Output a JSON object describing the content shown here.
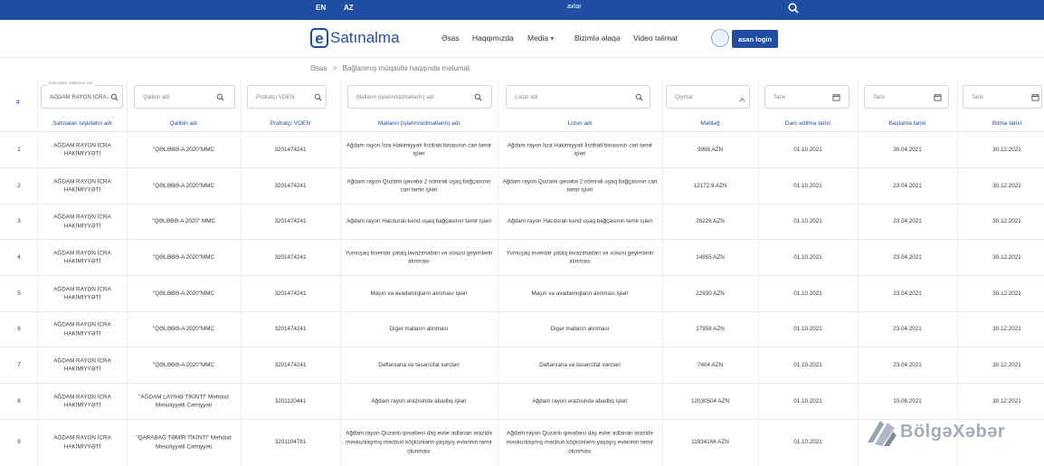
{
  "topbar": {
    "lang_en": "EN",
    "lang_az": "AZ",
    "search_text": "axtar",
    "search_icon": "search-icon"
  },
  "colors": {
    "primary": "#1f4ea3",
    "header_text": "#1f4ea3",
    "row_text": "#3a3a3a"
  },
  "navbar": {
    "logo_letter": "e",
    "logo_text": "Satınalma",
    "items": [
      "Əsas",
      "Haqqımızda",
      "Media",
      "Bizimlə əlaqə",
      "Video təlimat"
    ],
    "login_label": "asan login"
  },
  "breadcrumb": {
    "home": "Əsas",
    "separator": ">",
    "current": "Bağlanmış müqavilə haqqında məlumat"
  },
  "filters": {
    "hash": "#",
    "org_label": "Satınalan təşkilatın adı",
    "org_value": "AĞDAM RAYON İCRA..",
    "template_placeholder": "Qalibin adı",
    "voen_placeholder": "Podratçı VOEN",
    "goods_placeholder": "Malların (işlərin/xidmətlərin) adı",
    "lot_placeholder": "Lotun adı",
    "price_placeholder": "Qiymət",
    "date1_placeholder": "Tarix",
    "date2_placeholder": "Tarix",
    "date3_placeholder": "Tarix"
  },
  "table": {
    "columns": [
      "Satınalan təşkilatın adı",
      "Qalibin adı",
      "Podratçı VOEN",
      "Malların (işlərin/xidmətlərin) adı",
      "Lotun adı",
      "Məbləğ",
      "Dərc edilmə tarixi",
      "Başlama tarixi",
      "Bitmə tarixi"
    ],
    "rows": [
      {
        "num": "1",
        "org": "AĞDAM RAYON İCRA HAKİMİYYƏTİ",
        "winner": "\"QƏLƏBƏ-A 2020\"MMC",
        "voen": "3201474241",
        "goods": "Ağdam rayon İcra Hakimiyyəti İnzibati binasının cari təmir işləri",
        "lot": "Ağdam rayon İcra Hakimiyyəti İnzibati binasının cari təmir işləri",
        "amount": "9998 AZN",
        "published": "01.10.2021",
        "start": "30.04.2021",
        "end": "30.12.2021"
      },
      {
        "num": "2",
        "org": "AĞDAM RAYON İCRA HAKİMİYYƏTİ",
        "winner": "\"QƏLƏBƏ-A 2020\"MMC",
        "voen": "3201474241",
        "goods": "Ağdam rayon Quzanlı qəsəbə 2 nömrəli uşaq bağçasının cari təmir işləri",
        "lot": "Ağdam rayon Quzanlı qəsəbə 2 nömrəli uşaq bağçasının cari təmir işləri",
        "amount": "12172.9 AZN",
        "published": "01.10.2021",
        "start": "23.04.2021",
        "end": "30.12.2021"
      },
      {
        "num": "3",
        "org": "AĞDAM RAYON İCRA HAKİMİYYƏTİ",
        "winner": "\"QƏLƏBƏ-A 2020\" MMC",
        "voen": "3201474241",
        "goods": "Ağdam rayon Hacıturalı kənd uşaq bağçasının təmir işləri",
        "lot": "Ağdam rayon Hacıturalı kənd uşaq bağçasının təmir işləri",
        "amount": "26226 AZN",
        "published": "01.10.2021",
        "start": "23.04.2021",
        "end": "30.12.2021"
      },
      {
        "num": "4",
        "org": "AĞDAM RAYON İCRA HAKİMİYYƏTİ",
        "winner": "\"QƏLƏBƏ-A 2020\"MMC",
        "voen": "3201474241",
        "goods": "Yumuşaq inventar yataq ləvazimatları və xüsusi geyimlərin alınması",
        "lot": "Yumuşaq inventar yataq ləvazimatları və xüsusi geyimlərin alınması",
        "amount": "14955 AZN",
        "published": "01.10.2021",
        "start": "23.04.2021",
        "end": "30.12.2021"
      },
      {
        "num": "5",
        "org": "AĞDAM RAYON İCRA HAKİMİYYƏTİ",
        "winner": "\"QƏLƏBƏ-A 2020\"MMC",
        "voen": "3201474241",
        "goods": "Maşın və avadanlıqların alınması işləri",
        "lot": "Maşın və avadanlıqların alınması işləri",
        "amount": "22930 AZN",
        "published": "01.10.2021",
        "start": "23.04.2021",
        "end": "30.12.2021"
      },
      {
        "num": "6",
        "org": "AĞDAM RAYON İCRA HAKİMİYYƏTİ",
        "winner": "\"QƏLƏBƏ-A 2020\"MMC",
        "voen": "3201474241",
        "goods": "Digər malların alınması",
        "lot": "Digər malların alınması",
        "amount": "17958 AZN",
        "published": "01.10.2021",
        "start": "23.04.2021",
        "end": "30.12.2021"
      },
      {
        "num": "7",
        "org": "AĞDAM RAYON İCRA HAKİMİYYƏTİ",
        "winner": "\"QƏLƏBƏ-A 2020\"MMC",
        "voen": "3201474241",
        "goods": "Dəftərxana və təsərrüfat xərcləri",
        "lot": "Dəftərxana və təsərrüfat xərcləri",
        "amount": "7404 AZN",
        "published": "01.10.2021",
        "start": "23.04.2021",
        "end": "30.12.2021"
      },
      {
        "num": "8",
        "org": "AĞDAM RAYON İCRA HAKİMİYYƏTİ",
        "winner": "\"AĞDAM LAYİHƏ TİKİNTİ\" Məhdud Məsuliyyətli Cəmiyyəti",
        "voen": "3201120441",
        "goods": "Ağdam rayon ərazisində abadlıq işləri",
        "lot": "Ağdam rayon ərazisində abadlıq işləri",
        "amount": "12030504 AZN",
        "published": "01.10.2021",
        "start": "10.06.2021",
        "end": "30.12.2021"
      },
      {
        "num": "9",
        "org": "AĞDAM RAYON İCRA HAKİMİYYƏTİ",
        "winner": "\"QARABAĞ TƏMİR TİKİNTİ\" Məhdud Məsuliyyətli Cəmiyyəti",
        "voen": "3201104781",
        "goods": "Ağdam rayon Quzanlı qəsəbəsi daş evlər adlanan ərazidə məskunlaşmış məcburi köçkünlərin yaşayış evlərinin təmir olunması",
        "lot": "Ağdam rayon Quzanlı qəsəbəsi daş evlər adlanan ərazidə məskunlaşmış məcburi köçkünlərin yaşayış evlərinin təmir olunması",
        "amount": "11934166 AZN",
        "published": "01.10.2021",
        "start": "",
        "end": ""
      }
    ]
  },
  "watermark": {
    "text": "BölgəXəbər",
    "icon": "bolgexeber-logo-icon"
  }
}
